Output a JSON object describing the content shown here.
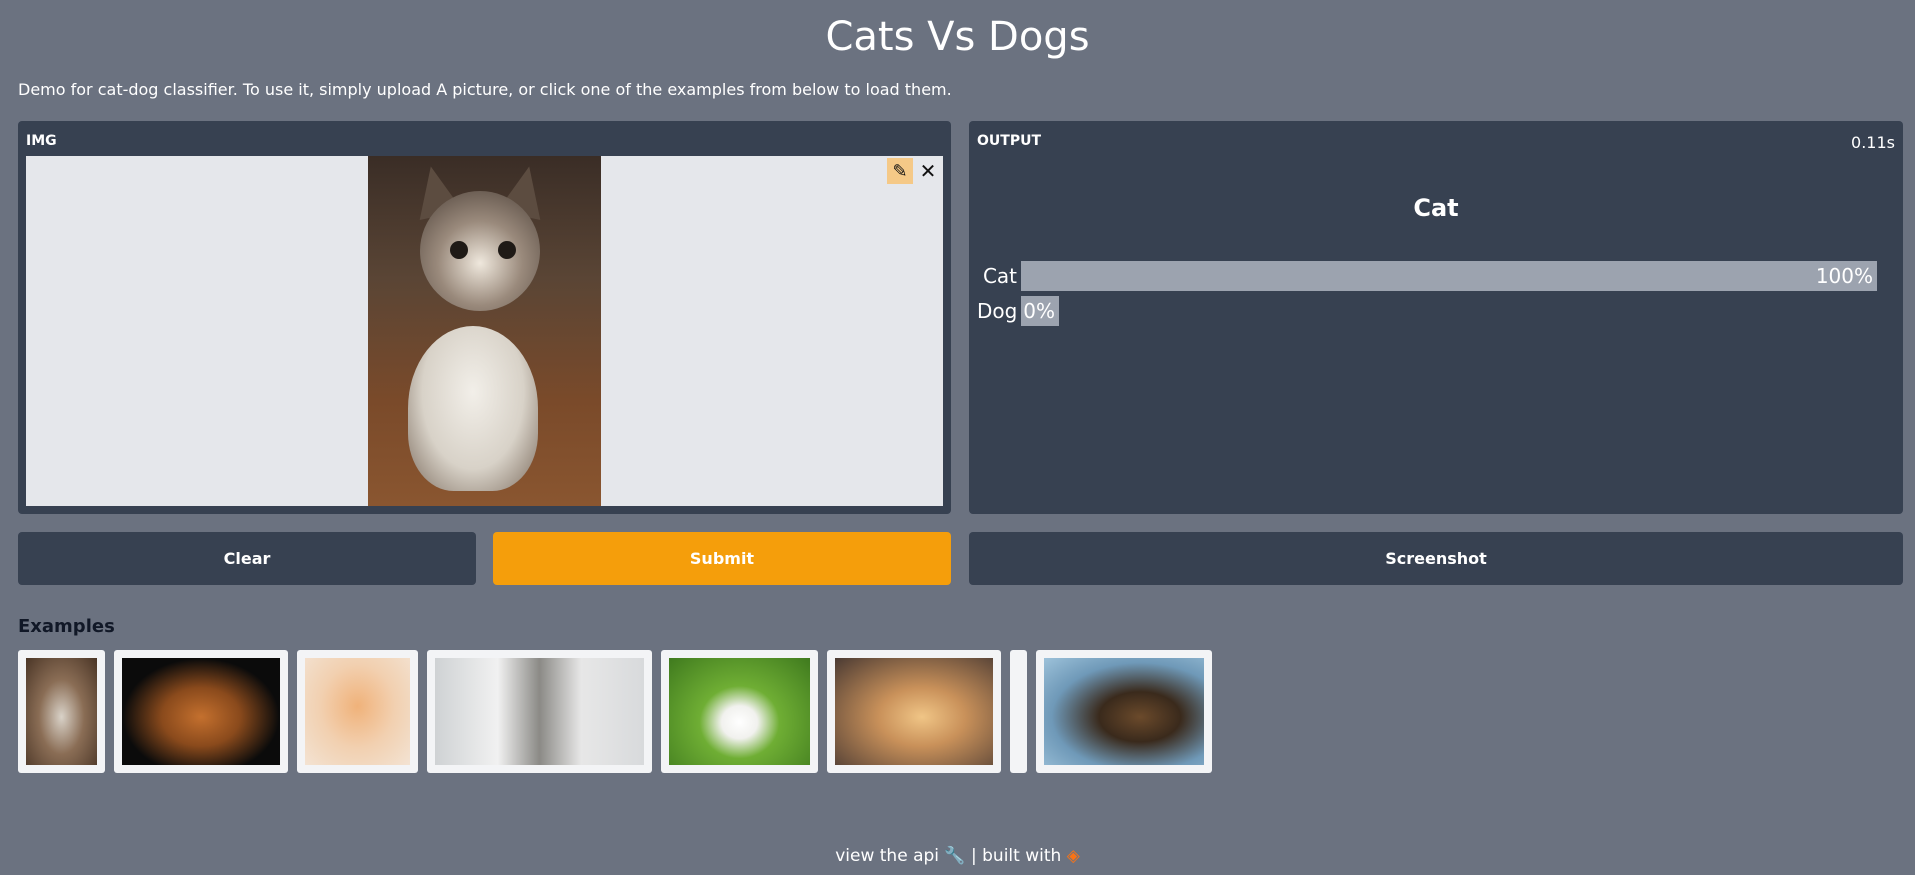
{
  "header": {
    "title": "Cats Vs Dogs",
    "description": "Demo for cat-dog classifier. To use it, simply upload A picture, or click one of the examples from below to load them."
  },
  "input": {
    "label": "IMG",
    "edit_icon": "pencil-icon",
    "clear_icon": "close-icon"
  },
  "output": {
    "label": "OUTPUT",
    "time": "0.11s",
    "predicted": "Cat",
    "confidences": [
      {
        "label": "Cat",
        "value": 1.0,
        "display": "100%"
      },
      {
        "label": "Dog",
        "value": 0.0,
        "display": "0%"
      }
    ]
  },
  "buttons": {
    "clear": "Clear",
    "submit": "Submit",
    "screenshot": "Screenshot"
  },
  "examples": {
    "label": "Examples",
    "items": [
      {
        "name": "kitten-sitting"
      },
      {
        "name": "abyssinian-cat"
      },
      {
        "name": "orange-kitten-sleeping"
      },
      {
        "name": "cat-with-sunglasses"
      },
      {
        "name": "blank"
      },
      {
        "name": "white-puppy-on-grass"
      },
      {
        "name": "golden-retriever-puppy"
      },
      {
        "name": "german-shepherd"
      }
    ]
  },
  "footer": {
    "api_text": "view the api",
    "api_icon": "wrench-icon",
    "separator": "|",
    "built_with": "built with",
    "logo_icon": "gradio-logo-icon"
  },
  "colors": {
    "background": "#6b7280",
    "panel": "#374151",
    "accent": "#f59e0b",
    "bar": "#9ca3af"
  }
}
